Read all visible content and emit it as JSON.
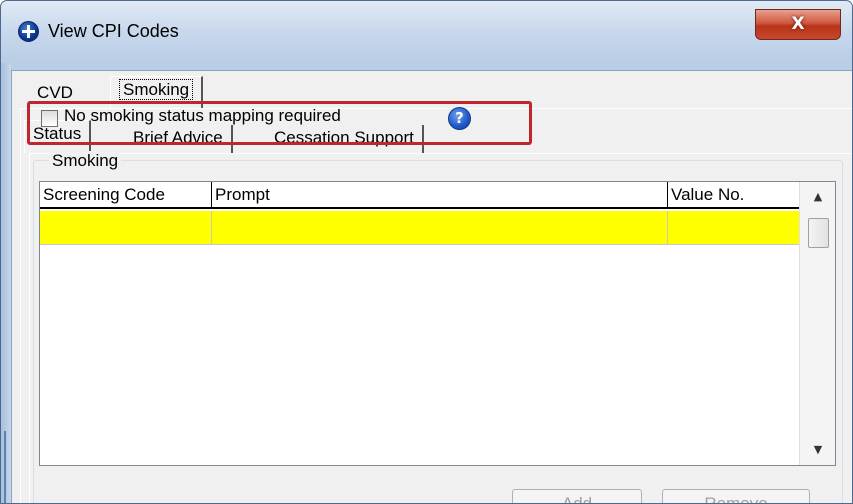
{
  "window": {
    "title": "View CPI Codes",
    "close_label": "X"
  },
  "outer_tabs": [
    {
      "label": "CVD",
      "selected": false
    },
    {
      "label": "Smoking",
      "selected": true
    }
  ],
  "inner_tabs": [
    {
      "label": "Status",
      "selected": true
    },
    {
      "label": "Brief Advice",
      "selected": false
    },
    {
      "label": "Cessation Support",
      "selected": false
    }
  ],
  "status": {
    "checkbox_label": "No smoking status mapping required",
    "checkbox_checked": false,
    "help_glyph": "?",
    "group_title": "Smoking"
  },
  "grid": {
    "columns": [
      "Screening Code",
      "Prompt",
      "Value No."
    ],
    "rows": [
      {
        "screening_code": "",
        "prompt": "",
        "value_no": "",
        "highlight": "#ffff00"
      }
    ],
    "scroll_up_glyph": "▲",
    "scroll_down_glyph": "▼"
  },
  "buttons": {
    "add": "Add",
    "remove": "Remove"
  },
  "colors": {
    "highlight_outline": "#c0272d",
    "row_highlight": "#ffff00",
    "close_button": "#c9482d"
  }
}
